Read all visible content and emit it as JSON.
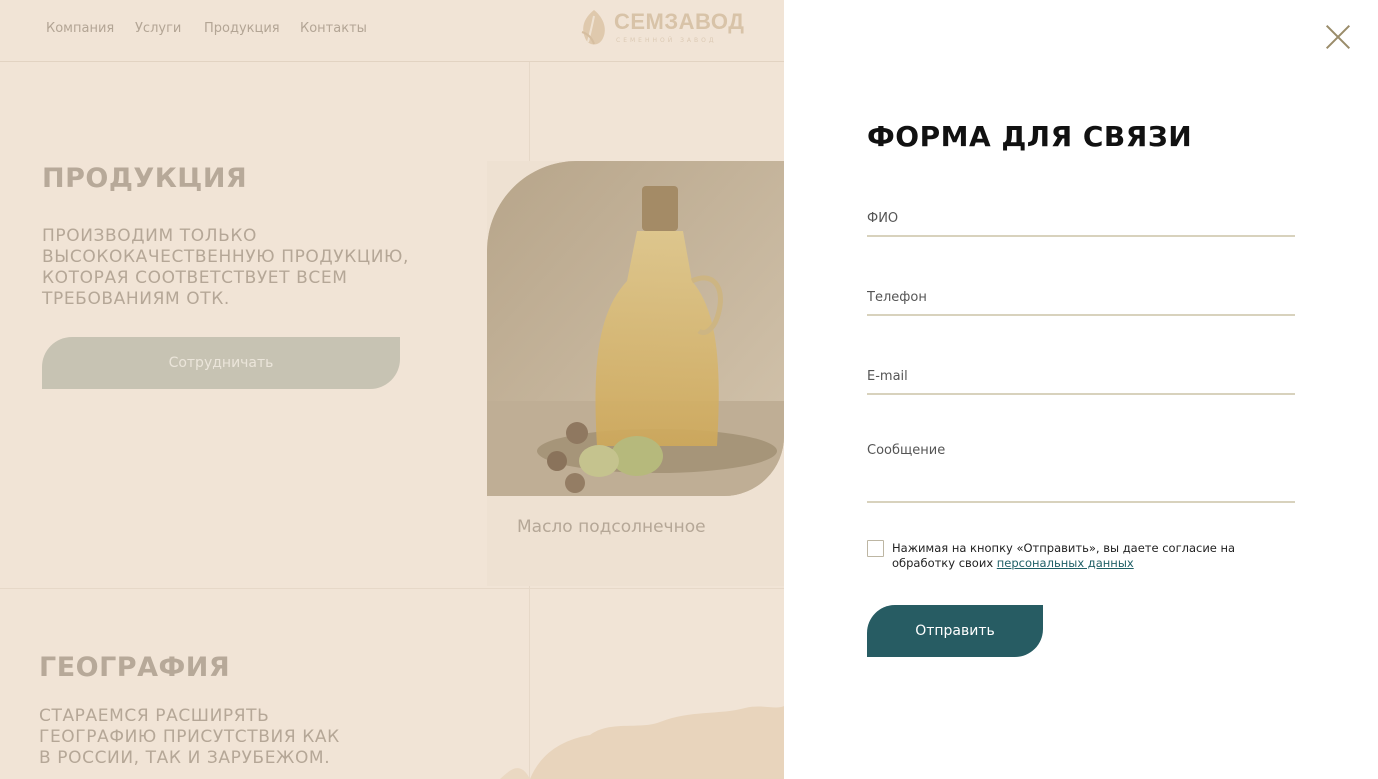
{
  "nav": {
    "items": [
      "Компания",
      "Услуги",
      "Продукция",
      "Контакты"
    ]
  },
  "logo": {
    "name": "СЕМЗАВОД",
    "tagline": "СЕМЕННОЙ ЗАВОД"
  },
  "products_section": {
    "title": "ПРОДУКЦИЯ",
    "text_lines": [
      "ПРОИЗВОДИМ ТОЛЬКО",
      "ВЫСОКОКАЧЕСТВЕННУЮ ПРОДУКЦИЮ,",
      "КОТОРАЯ СООТВЕТСТВУЕТ ВСЕМ",
      "ТРЕБОВАНИЯМ ОТК."
    ],
    "cta_label": "Сотрудничать",
    "card_name": "Масло подсолнечное"
  },
  "geo_section": {
    "title": "ГЕОГРАФИЯ",
    "text_lines": [
      "СТАРАЕМСЯ РАСШИРЯТЬ",
      "ГЕОГРАФИЮ ПРИСУТСТВИЯ КАК",
      "В РОССИИ, ТАК И ЗАРУБЕЖОМ."
    ]
  },
  "form": {
    "title": "ФОРМА ДЛЯ СВЯЗИ",
    "name_placeholder": "ФИО",
    "phone_placeholder": "Телефон",
    "email_placeholder": "E-mail",
    "message_placeholder": "Сообщение",
    "consent_text": "Нажимая на кнопку «Отправить», вы даете согласие на обработку своих ",
    "consent_link": "персональных данных",
    "submit_label": "Отправить",
    "consent_checked": false
  },
  "colors": {
    "accent": "#275c63",
    "close": "#9a8c6a",
    "underline": "#d8d2bd",
    "background": "#f1e4d6"
  },
  "icons": {
    "close": "close-icon",
    "logo": "leaf-logo-icon"
  }
}
